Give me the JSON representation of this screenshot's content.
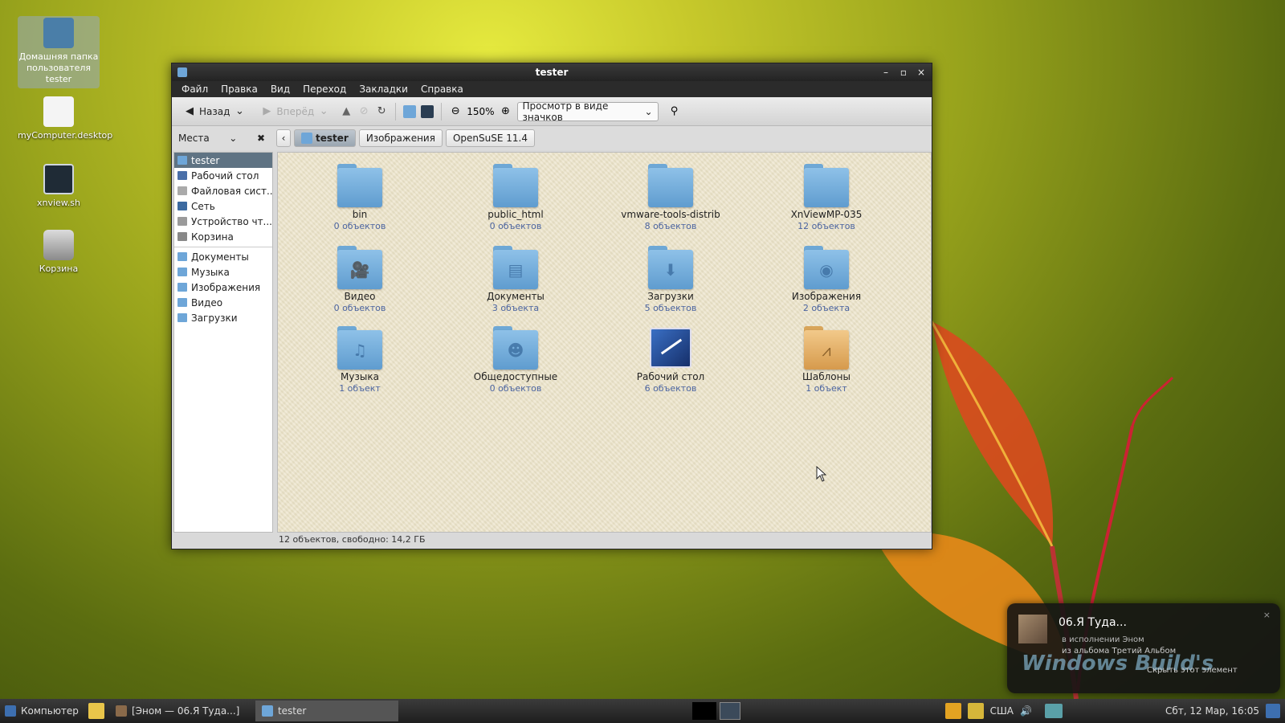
{
  "desktop": {
    "icons": [
      {
        "label": "Домашняя папка пользователя tester"
      },
      {
        "label": "myComputer.desktop"
      },
      {
        "label": "xnview.sh"
      },
      {
        "label": "Корзина"
      }
    ]
  },
  "window": {
    "title": "tester",
    "controls": {
      "minimize": "–",
      "maximize": "▫",
      "close": "×"
    },
    "menu": [
      "Файл",
      "Правка",
      "Вид",
      "Переход",
      "Закладки",
      "Справка"
    ],
    "toolbar": {
      "back": "Назад",
      "forward": "Вперёд",
      "zoom": "150%",
      "view_mode": "Просмотр в виде значков"
    },
    "places_label": "Места",
    "breadcrumbs": [
      "tester",
      "Изображения",
      "OpenSuSE 11.4"
    ],
    "sidebar": {
      "group1": [
        {
          "label": "tester",
          "color": "#6ea6d8"
        },
        {
          "label": "Рабочий стол",
          "color": "#4a6fa8"
        },
        {
          "label": "Файловая сист...",
          "color": "#aaaaaa"
        },
        {
          "label": "Сеть",
          "color": "#3c6aa0"
        },
        {
          "label": "Устройство чт...",
          "color": "#9a9a9a"
        },
        {
          "label": "Корзина",
          "color": "#888888"
        }
      ],
      "group2": [
        {
          "label": "Документы",
          "color": "#6ea6d8"
        },
        {
          "label": "Музыка",
          "color": "#6ea6d8"
        },
        {
          "label": "Изображения",
          "color": "#6ea6d8"
        },
        {
          "label": "Видео",
          "color": "#6ea6d8"
        },
        {
          "label": "Загрузки",
          "color": "#6ea6d8"
        }
      ]
    },
    "items": [
      {
        "name": "bin",
        "count": "0 объектов",
        "icon": "folder"
      },
      {
        "name": "public_html",
        "count": "0 объектов",
        "icon": "folder"
      },
      {
        "name": "vmware-tools-distrib",
        "count": "8 объектов",
        "icon": "folder"
      },
      {
        "name": "XnViewMP-035",
        "count": "12 объектов",
        "icon": "folder"
      },
      {
        "name": "Видео",
        "count": "0 объектов",
        "icon": "video-folder"
      },
      {
        "name": "Документы",
        "count": "3 объекта",
        "icon": "documents-folder"
      },
      {
        "name": "Загрузки",
        "count": "5 объектов",
        "icon": "downloads-folder"
      },
      {
        "name": "Изображения",
        "count": "2 объекта",
        "icon": "pictures-folder"
      },
      {
        "name": "Музыка",
        "count": "1 объект",
        "icon": "music-folder"
      },
      {
        "name": "Общедоступные",
        "count": "0 объектов",
        "icon": "public-folder"
      },
      {
        "name": "Рабочий стол",
        "count": "6 объектов",
        "icon": "desktop-folder"
      },
      {
        "name": "Шаблоны",
        "count": "1 объект",
        "icon": "templates-folder"
      }
    ],
    "status": "12 объектов, свободно: 14,2 ГБ"
  },
  "notification": {
    "title": "06.Я Туда...",
    "artist_line": "в исполнении Эном",
    "album_line": "из альбома Третий Альбом",
    "watermark": "Windows Build's",
    "hide_text": "Скрыть этот элемент",
    "close": "×"
  },
  "taskbar": {
    "start": "Компьютер",
    "tasks": [
      {
        "label": "[Эном — 06.Я Туда...]"
      },
      {
        "label": "tester"
      }
    ],
    "layout": "США",
    "clock": "Сбт, 12 Мар, 16:05"
  }
}
